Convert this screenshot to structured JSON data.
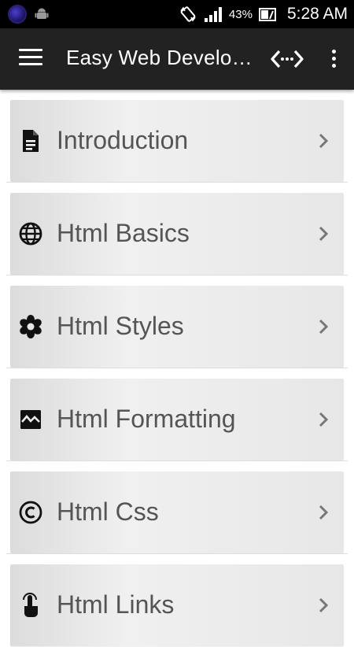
{
  "status_bar": {
    "battery_percent": "43%",
    "time": "5:28 AM",
    "icons": [
      "app-launcher-icon",
      "android-debug-icon",
      "rotate-icon",
      "signal-icon",
      "battery-icon"
    ]
  },
  "app_bar": {
    "title": "Easy Web Develo…",
    "menu_icon": "hamburger-menu-icon",
    "action_icon": "code-icon",
    "overflow_icon": "more-vert-icon"
  },
  "list": {
    "items": [
      {
        "label": "Introduction",
        "icon": "document-icon"
      },
      {
        "label": "Html Basics",
        "icon": "globe-icon"
      },
      {
        "label": "Html Styles",
        "icon": "flower-icon"
      },
      {
        "label": "Html Formatting",
        "icon": "image-broken-icon"
      },
      {
        "label": "Html Css",
        "icon": "copyright-icon"
      },
      {
        "label": "Html Links",
        "icon": "touch-icon"
      }
    ]
  },
  "colors": {
    "status_bar": "#000000",
    "app_bar": "#222222",
    "card_text": "#555555",
    "divider": "#dddddd"
  }
}
